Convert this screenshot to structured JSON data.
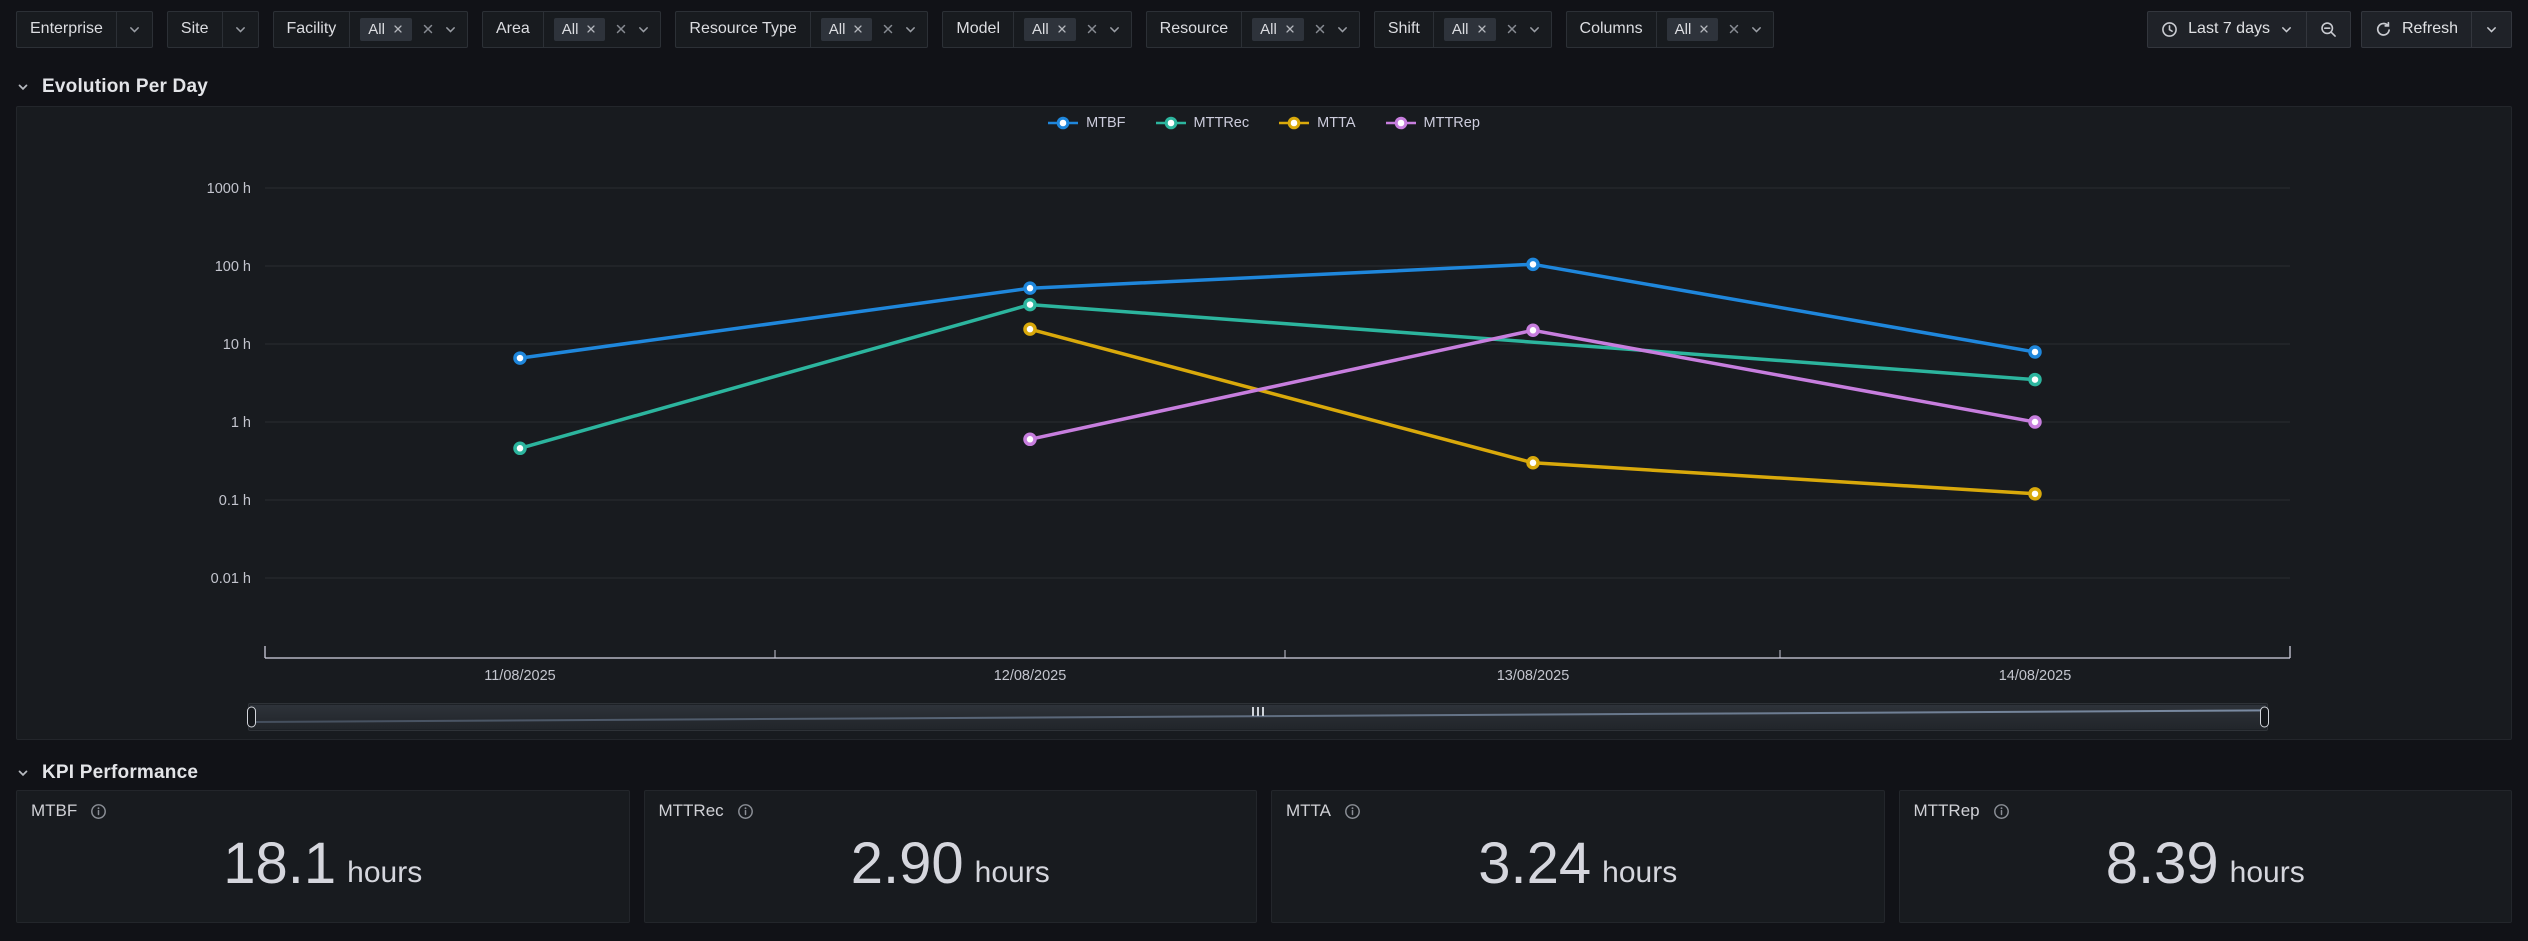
{
  "colors": {
    "page_bg": "#111217",
    "panel_bg": "#181b1f",
    "panel_border": "#23262b",
    "control_border": "#2c3036",
    "chip_bg": "#2e333b",
    "text_primary": "#d8d9da",
    "axis_text": "#c3c5ce",
    "grid_line": "rgba(204,204,220,0.10)",
    "axis_line": "rgba(204,204,220,0.65)"
  },
  "filter_bar": {
    "filters": [
      {
        "label": "Enterprise",
        "type": "simple"
      },
      {
        "label": "Site",
        "type": "simple"
      },
      {
        "label": "Facility",
        "type": "chip",
        "value": "All"
      },
      {
        "label": "Area",
        "type": "chip",
        "value": "All"
      },
      {
        "label": "Resource Type",
        "type": "chip",
        "value": "All"
      },
      {
        "label": "Model",
        "type": "chip",
        "value": "All"
      },
      {
        "label": "Resource",
        "type": "chip",
        "value": "All"
      },
      {
        "label": "Shift",
        "type": "chip",
        "value": "All"
      },
      {
        "label": "Columns",
        "type": "chip",
        "value": "All"
      }
    ],
    "time_picker": {
      "label": "Last 7 days"
    },
    "refresh": {
      "label": "Refresh"
    }
  },
  "sections": {
    "evolution": {
      "title": "Evolution Per Day"
    },
    "kpi": {
      "title": "KPI Performance"
    }
  },
  "chart_data": {
    "type": "line",
    "x": [
      "11/08/2025",
      "12/08/2025",
      "13/08/2025",
      "14/08/2025"
    ],
    "y_scale": "log",
    "y_unit": "h",
    "y_ticks": [
      "1000 h",
      "100 h",
      "10 h",
      "1 h",
      "0.1 h",
      "0.01 h"
    ],
    "y_tick_values": [
      1000,
      100,
      10,
      1,
      0.1,
      0.01
    ],
    "ylim": [
      0.01,
      1000
    ],
    "grid": true,
    "legend_position": "top",
    "series": [
      {
        "name": "MTBF",
        "color": "#1f87dc",
        "values": [
          6.6,
          52,
          105,
          7.9
        ]
      },
      {
        "name": "MTTRec",
        "color": "#2cb59e",
        "values": [
          0.46,
          32,
          null,
          3.5
        ]
      },
      {
        "name": "MTTA",
        "color": "#d9a90b",
        "values": [
          null,
          15.5,
          0.3,
          0.12
        ]
      },
      {
        "name": "MTTRep",
        "color": "#c77ede",
        "values": [
          null,
          0.6,
          15,
          1.0
        ]
      }
    ]
  },
  "kpi_cards": [
    {
      "title": "MTBF",
      "value": "18.1",
      "unit": "hours"
    },
    {
      "title": "MTTRec",
      "value": "2.90",
      "unit": "hours"
    },
    {
      "title": "MTTA",
      "value": "3.24",
      "unit": "hours"
    },
    {
      "title": "MTTRep",
      "value": "8.39",
      "unit": "hours"
    }
  ]
}
